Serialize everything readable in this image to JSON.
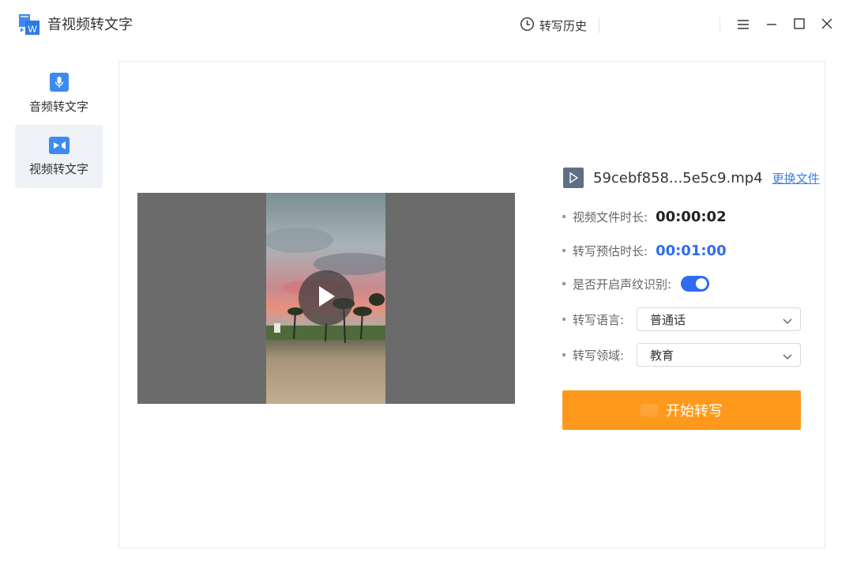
{
  "app": {
    "title": "音视频转文字",
    "logo_letter": "W"
  },
  "header": {
    "history_label": "转写历史"
  },
  "sidebar": {
    "items": [
      {
        "label": "音频转文字",
        "icon": "microphone-icon",
        "active": false
      },
      {
        "label": "视频转文字",
        "icon": "video-camera-icon",
        "active": true
      }
    ]
  },
  "file": {
    "name": "59cebf858...5e5c9.mp4",
    "change_label": "更换文件"
  },
  "info": {
    "duration_label": "视频文件时长:",
    "duration_value": "00:00:02",
    "estimate_label": "转写预估时长:",
    "estimate_value": "00:01:00",
    "voiceprint_label": "是否开启声纹识别:",
    "voiceprint_on": true,
    "language_label": "转写语言:",
    "language_value": "普通话",
    "domain_label": "转写领域:",
    "domain_value": "教育"
  },
  "actions": {
    "start_label": "开始转写"
  },
  "colors": {
    "accent_blue": "#3d8af0",
    "estimate_blue": "#2f6cf3",
    "start_orange": "#ff991c",
    "link_blue": "#3d7fe0"
  }
}
